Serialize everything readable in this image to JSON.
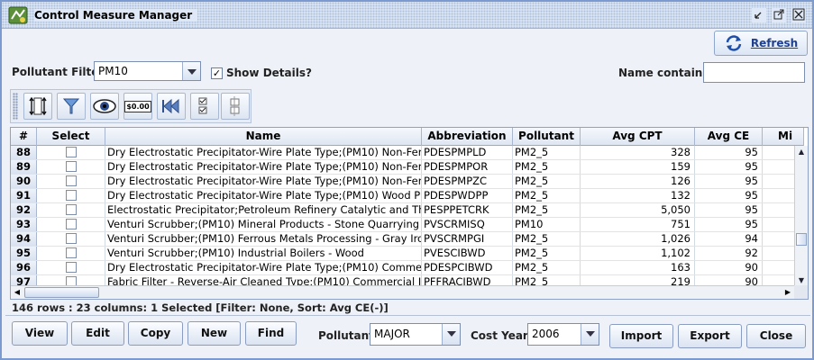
{
  "window": {
    "title": "Control Measure Manager",
    "icon": "app-icon",
    "controls": [
      "minimize-icon",
      "maximize-icon",
      "close-icon"
    ]
  },
  "header": {
    "refresh_label": "Refresh",
    "pollutant_filter_label": "Pollutant Filter:",
    "pollutant_filter_value": "PM10",
    "show_details_label": "Show Details?",
    "show_details_checked": true,
    "name_contains_label": "Name contains:",
    "name_contains_value": ""
  },
  "toolbar": {
    "tools": [
      "sort-icon",
      "filter-icon",
      "view-columns-icon",
      "format-numbers-icon",
      "reset-icon",
      "select-all-icon",
      "clear-selection-icon"
    ],
    "format_label": "$0.00"
  },
  "table": {
    "columns": [
      "#",
      "Select",
      "Name",
      "Abbreviation",
      "Pollutant",
      "Avg CPT",
      "Avg CE",
      "Mi"
    ],
    "rows": [
      {
        "num": "88",
        "name": "Dry Electrostatic Precipitator-Wire Plate Type;(PM10) Non-Ferr...",
        "abbr": "PDESPMPLD",
        "pollutant": "PM2_5",
        "cpt": "328",
        "ce": "95",
        "selected": false
      },
      {
        "num": "89",
        "name": "Dry Electrostatic Precipitator-Wire Plate Type;(PM10) Non-Ferr...",
        "abbr": "PDESPMPOR",
        "pollutant": "PM2_5",
        "cpt": "159",
        "ce": "95",
        "selected": false
      },
      {
        "num": "90",
        "name": "Dry Electrostatic Precipitator-Wire Plate Type;(PM10) Non-Ferr...",
        "abbr": "PDESPMPZC",
        "pollutant": "PM2_5",
        "cpt": "126",
        "ce": "95",
        "selected": false
      },
      {
        "num": "91",
        "name": "Dry Electrostatic Precipitator-Wire Plate Type;(PM10) Wood Pu...",
        "abbr": "PDESPWDPP",
        "pollutant": "PM2_5",
        "cpt": "132",
        "ce": "95",
        "selected": false
      },
      {
        "num": "92",
        "name": "Electrostatic Precipitator;Petroleum Refinery Catalytic and The...",
        "abbr": "PESPPETCRK",
        "pollutant": "PM2_5",
        "cpt": "5,050",
        "ce": "95",
        "selected": false
      },
      {
        "num": "93",
        "name": "Venturi Scrubber;(PM10) Mineral Products - Stone Quarrying &...",
        "abbr": "PVSCRMISQ",
        "pollutant": "PM10",
        "cpt": "751",
        "ce": "95",
        "selected": false
      },
      {
        "num": "94",
        "name": "Venturi Scrubber;(PM10) Ferrous Metals Processing - Gray Iro...",
        "abbr": "PVSCRMPGI",
        "pollutant": "PM2_5",
        "cpt": "1,026",
        "ce": "94",
        "selected": false
      },
      {
        "num": "95",
        "name": "Venturi Scrubber;(PM10) Industrial Boilers - Wood",
        "abbr": "PVESCIBWD",
        "pollutant": "PM2_5",
        "cpt": "1,102",
        "ce": "92",
        "selected": false
      },
      {
        "num": "96",
        "name": "Dry Electrostatic Precipitator-Wire Plate Type;(PM10) Commer...",
        "abbr": "PDESPCIBWD",
        "pollutant": "PM2_5",
        "cpt": "163",
        "ce": "90",
        "selected": false
      },
      {
        "num": "97",
        "name": "Fabric Filter - Reverse-Air Cleaned Type;(PM10) Commercial I...",
        "abbr": "PFFRACIBWD",
        "pollutant": "PM2_5",
        "cpt": "219",
        "ce": "90",
        "selected": false
      }
    ]
  },
  "status": "146 rows : 23 columns: 1 Selected [Filter: None, Sort: Avg CE(-)]",
  "footer": {
    "view_label": "View",
    "edit_label": "Edit",
    "copy_label": "Copy",
    "new_label": "New",
    "find_label": "Find",
    "pollutant_label": "Pollutant:",
    "pollutant_value": "MAJOR",
    "cost_year_label": "Cost Year:",
    "cost_year_value": "2006",
    "import_label": "Import",
    "export_label": "Export",
    "close_label": "Close"
  }
}
